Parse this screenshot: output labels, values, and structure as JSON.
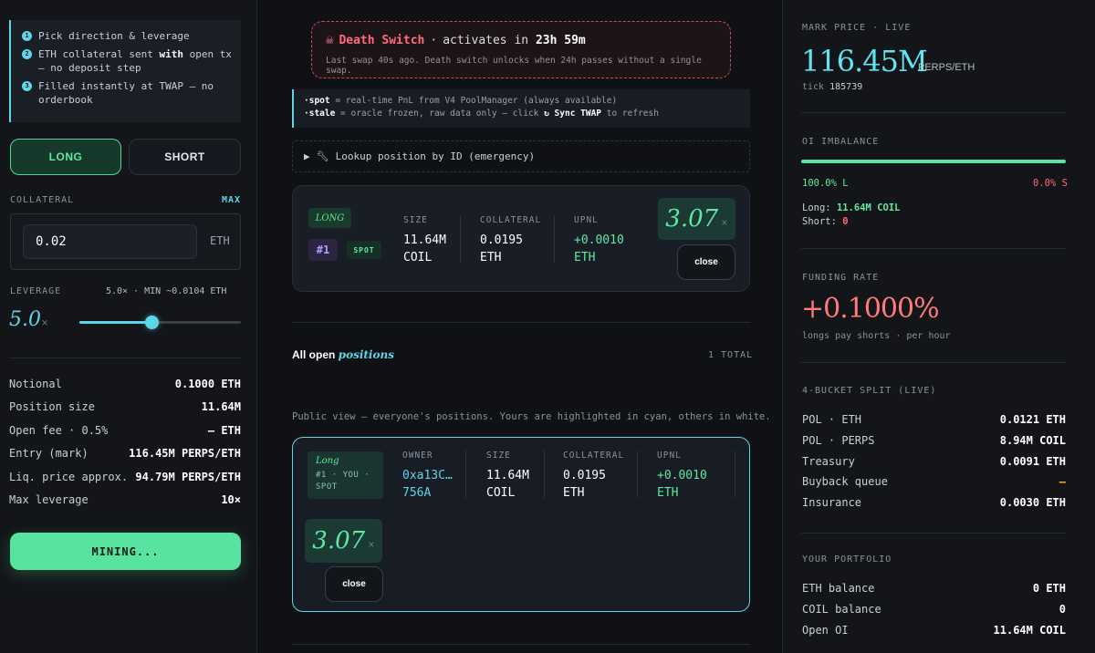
{
  "steps": [
    {
      "icon": "step-1-icon",
      "num": "1",
      "text": "Pick direction & leverage"
    },
    {
      "icon": "step-2-icon",
      "num": "2",
      "text_pre": "ETH collateral sent ",
      "text_bold": "with",
      "text_post": " open tx — no deposit step"
    },
    {
      "icon": "step-3-icon",
      "num": "3",
      "text": "Filled instantly at TWAP — no orderbook"
    }
  ],
  "direction": {
    "long_label": "LONG",
    "short_label": "SHORT",
    "selected": "long"
  },
  "collateral": {
    "label": "COLLATERAL",
    "max_label": "MAX",
    "value": "0.02",
    "unit": "ETH"
  },
  "leverage": {
    "label": "LEVERAGE",
    "info": "5.0× · MIN ~0.0104 ETH",
    "value": "5.0",
    "suffix": "×",
    "min": 1,
    "max": 10,
    "current": 5
  },
  "summary": [
    {
      "k": "Notional",
      "v": "0.1000 ETH"
    },
    {
      "k": "Position size",
      "v": "11.64M"
    },
    {
      "k": "Open fee · 0.5%",
      "v": "— ETH"
    },
    {
      "k": "Entry (mark)",
      "v": "116.45M PERPS/ETH"
    },
    {
      "k": "Liq. price approx.",
      "v": "94.79M PERPS/ETH"
    },
    {
      "k": "Max leverage",
      "v": "10×"
    }
  ],
  "submit_label": "MINING...",
  "death": {
    "icon": "skull-icon",
    "title": "Death Switch",
    "sep": "·",
    "activates": "activates in",
    "time": "23h 59m",
    "subtitle": "Last swap 40s ago. Death switch unlocks when 24h passes without a single swap."
  },
  "legend": {
    "spot_key": "·spot",
    "spot_text": " = real-time PnL from V4 PoolManager (always available)",
    "stale_key": "·stale",
    "stale_text": " = oracle frozen, raw data only — click ",
    "sync_label": "↻ Sync TWAP",
    "stale_tail": " to refresh"
  },
  "lookup": {
    "arrow": "▶",
    "icon": "wrench-icon",
    "label": "Lookup position by ID (emergency)"
  },
  "my_position": {
    "side": "LONG",
    "id": "#1",
    "tag": "SPOT",
    "size_label": "SIZE",
    "size_value": "11.64M",
    "size_unit": "COIL",
    "collateral_label": "COLLATERAL",
    "collateral_value": "0.0195",
    "collateral_unit": "ETH",
    "upnl_label": "UPNL",
    "upnl_value": "+0.0010",
    "upnl_unit": "ETH",
    "multiple": "3.07",
    "multiple_suffix": "×",
    "close_label": "close"
  },
  "all_positions": {
    "title_pre": "All open ",
    "title_em": "positions",
    "total": "1 TOTAL",
    "note": "Public view — everyone's positions. Yours are highlighted in cyan, others in white.",
    "items": [
      {
        "side": "Long",
        "meta1": "#1 · YOU ·",
        "meta2": "SPOT",
        "owner_label": "OWNER",
        "owner_line1": "0xa13C…",
        "owner_line2": "756A",
        "size_label": "SIZE",
        "size_value": "11.64M",
        "size_unit": "COIL",
        "collateral_label": "COLLATERAL",
        "collateral_value": "0.0195",
        "collateral_unit": "ETH",
        "upnl_label": "UPNL",
        "upnl_value": "+0.0010",
        "upnl_unit": "ETH",
        "multiple": "3.07",
        "multiple_suffix": "×",
        "close_label": "close"
      }
    ]
  },
  "mark": {
    "label": "MARK PRICE · LIVE",
    "value": "116.45M",
    "unit": "PERPS/ETH",
    "tick_label": "tick",
    "tick_value": "185739"
  },
  "oi": {
    "label": "OI IMBALANCE",
    "long_pct": "100.0% L",
    "short_pct": "0.0% S",
    "long_fraction": 1.0,
    "long_label": "Long: ",
    "long_value": "11.64M COIL",
    "short_label": "Short: ",
    "short_value": "0"
  },
  "funding": {
    "label": "FUNDING RATE",
    "value": "+0.1000%",
    "sub": "longs pay shorts · per hour"
  },
  "bucket": {
    "label": "4-BUCKET SPLIT (LIVE)",
    "rows": [
      {
        "k": "POL · ETH",
        "v": "0.0121 ETH",
        "style": ""
      },
      {
        "k": "POL · PERPS",
        "v": "8.94M COIL",
        "style": ""
      },
      {
        "k": "Treasury",
        "v": "0.0091 ETH",
        "style": ""
      },
      {
        "k": "Buyback queue",
        "v": "—",
        "style": "orange"
      },
      {
        "k": "Insurance",
        "v": "0.0030 ETH",
        "style": ""
      }
    ]
  },
  "portfolio": {
    "label": "YOUR PORTFOLIO",
    "rows": [
      {
        "k": "ETH balance",
        "v": "0 ETH"
      },
      {
        "k": "COIL balance",
        "v": "0"
      },
      {
        "k": "Open OI",
        "v": "11.64M COIL"
      }
    ]
  },
  "colors": {
    "accent": "#5fd6e8",
    "green": "#58e3a0",
    "red": "#ff6b7d",
    "orange": "#f5a623"
  }
}
